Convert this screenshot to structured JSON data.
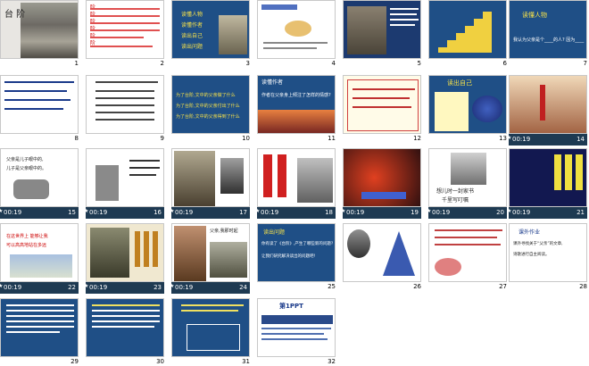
{
  "slides": [
    {
      "num": "1",
      "title": "台 阶"
    },
    {
      "num": "2",
      "lines": [
        "阶",
        "阶",
        "阶",
        "阶",
        "阶"
      ]
    },
    {
      "num": "3",
      "lines": [
        "读懂人物",
        "读懂作者",
        "读出自己",
        "读出问题"
      ]
    },
    {
      "num": "4"
    },
    {
      "num": "5"
    },
    {
      "num": "6"
    },
    {
      "num": "7",
      "heading": "读懂人物",
      "sub": "我认为父亲是个____的人? 因为____"
    },
    {
      "num": "8"
    },
    {
      "num": "9"
    },
    {
      "num": "10",
      "lines": [
        "为了台阶,文中的父亲做了什么",
        "为了台阶,文中的父亲付出了什么",
        "为了台阶,文中的父亲得到了什么"
      ]
    },
    {
      "num": "11",
      "heading": "读懂作者",
      "sub": "作者在父亲身上倾注了怎样的情感?"
    },
    {
      "num": "12"
    },
    {
      "num": "13",
      "heading": "读出自己"
    },
    {
      "num": "14",
      "time": "00:19"
    },
    {
      "num": "15",
      "time": "00:19",
      "lines": [
        "父亲是儿子眼中的,",
        "儿子是父亲眼中的。"
      ]
    },
    {
      "num": "16",
      "time": "00:19"
    },
    {
      "num": "17",
      "time": "00:19"
    },
    {
      "num": "18",
      "time": "00:19"
    },
    {
      "num": "19",
      "time": "00:19"
    },
    {
      "num": "20",
      "time": "00:19",
      "lines": [
        "想儿时一封家书",
        "千里写叮嘱"
      ]
    },
    {
      "num": "21",
      "time": "00:19"
    },
    {
      "num": "22",
      "time": "00:19",
      "lines": [
        "在这世界上 能够让我",
        "可以高高地站在多远"
      ]
    },
    {
      "num": "23",
      "time": "00:19"
    },
    {
      "num": "24",
      "time": "00:19",
      "lines": [
        "父亲,我那时起",
        "父亲",
        "你"
      ]
    },
    {
      "num": "25",
      "heading": "读出问题",
      "lines": [
        "你有读了《台阶》,产生了哪些新的问题?",
        "让我们研究解决读出的问题吧!"
      ]
    },
    {
      "num": "26"
    },
    {
      "num": "27"
    },
    {
      "num": "28",
      "heading": "课外作业",
      "lines": [
        "课外寻找关于“父亲”的文章,",
        "诗歌进行自主阅读。"
      ]
    },
    {
      "num": "29"
    },
    {
      "num": "30"
    },
    {
      "num": "31"
    },
    {
      "num": "32",
      "heading": "第1PPT"
    }
  ]
}
